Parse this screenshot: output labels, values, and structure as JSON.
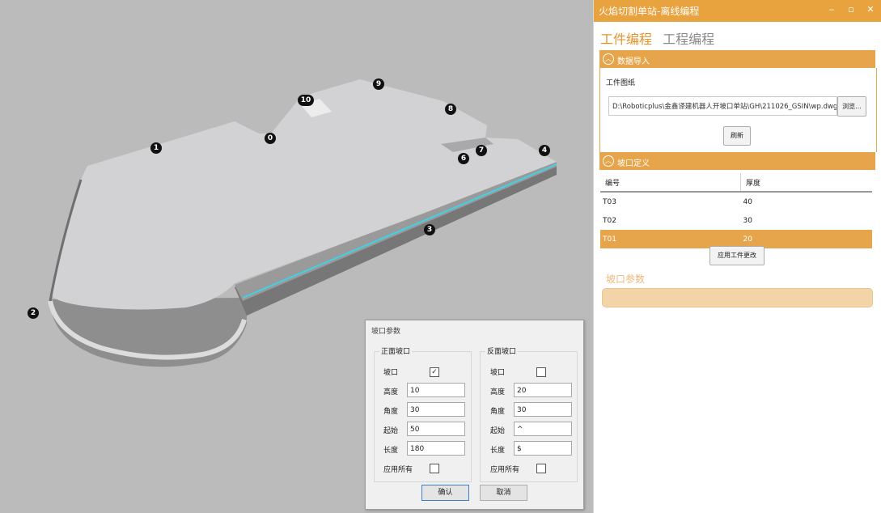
{
  "viewport": {
    "markers": [
      "1",
      "2",
      "3",
      "4",
      "6",
      "7",
      "8",
      "9",
      "10",
      "0"
    ]
  },
  "window": {
    "title": "火焰切割单站-离线编程",
    "controls": {
      "minimize": "‒",
      "maximize": "▫",
      "close": "✕"
    }
  },
  "tabs": [
    {
      "label": "工件编程",
      "active": true
    },
    {
      "label": "工程编程",
      "active": false
    }
  ],
  "data_import": {
    "header": "数据导入",
    "drawing_label": "工件图纸",
    "path_value": "D:\\Roboticplus\\金鑫译建机器人开坡口单站\\GH\\211026_GSIN\\wp.dwg",
    "browse_label": "浏览...",
    "refresh_label": "刷新"
  },
  "bevel_def": {
    "header": "坡口定义",
    "columns": [
      "编号",
      "厚度"
    ],
    "rows": [
      {
        "id": "T03",
        "thickness": "40"
      },
      {
        "id": "T02",
        "thickness": "30"
      },
      {
        "id": "T01",
        "thickness": "20"
      }
    ],
    "selected_row": 2,
    "apply_label": "应用工件更改"
  },
  "bevel_params_title": "坡口参数",
  "dialog": {
    "title": "坡口参数",
    "front": {
      "title": "正面坡口",
      "bevel_label": "坡口",
      "bevel_checked": true,
      "bevel_mark": "✓",
      "height_label": "高度",
      "height": "10",
      "angle_label": "角度",
      "angle": "30",
      "start_label": "起始",
      "start": "50",
      "length_label": "长度",
      "length": "180",
      "apply_all_label": "应用所有",
      "apply_all_checked": false
    },
    "back": {
      "title": "反面坡口",
      "bevel_label": "坡口",
      "bevel_checked": false,
      "height_label": "高度",
      "height": "20",
      "angle_label": "角度",
      "angle": "30",
      "start_label": "起始",
      "start": "^",
      "length_label": "长度",
      "length": "$",
      "apply_all_label": "应用所有",
      "apply_all_checked": false
    },
    "confirm_label": "确认",
    "cancel_label": "取消"
  },
  "colors": {
    "accent": "#e8a23e",
    "tab_active": "#e8922a",
    "selected_row": "#e6a54a",
    "edge_highlight": "#3fd2e6"
  }
}
